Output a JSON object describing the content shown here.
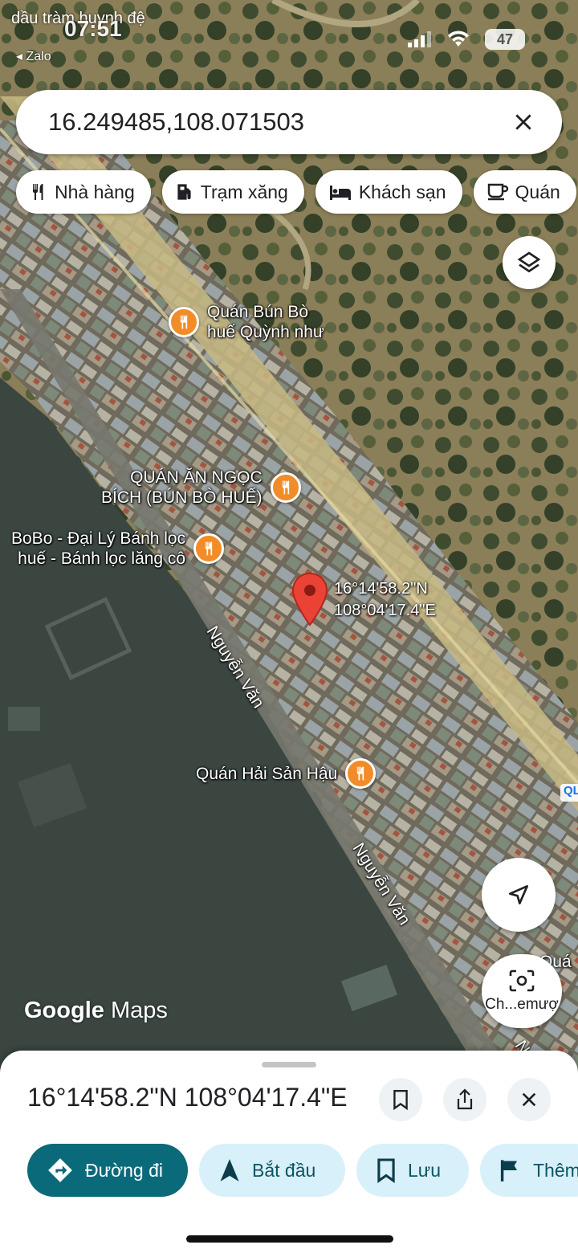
{
  "status_bar": {
    "back_app_text": "dầu tràm huynh đệ",
    "time": "07:51",
    "back_label": "◂ Zalo",
    "battery": "47"
  },
  "search": {
    "value": "16.249485,108.071503"
  },
  "chips": [
    {
      "label": "Nhà hàng",
      "icon": "fork-knife-icon"
    },
    {
      "label": "Trạm xăng",
      "icon": "gas-station-icon"
    },
    {
      "label": "Khách sạn",
      "icon": "bed-icon"
    },
    {
      "label": "Quán",
      "icon": "coffee-cup-icon"
    }
  ],
  "map": {
    "pois": [
      {
        "name_line1": "Quán Bún Bò",
        "name_line2": "huế Quỳnh như"
      },
      {
        "name_line1": "QUÁN ĂN NGỌC",
        "name_line2": "BÍCH (BÚN BÒ HUẾ)"
      },
      {
        "name_line1": "BoBo - Đại Lý Bánh lọc",
        "name_line2": "huế - Bánh lọc lăng cô"
      },
      {
        "name_line1": "Quán Hải Sản Hậu"
      }
    ],
    "streets": [
      "Nguyễn Văn",
      "Nguyễn Văn",
      "Nguy"
    ],
    "pin_coords_line1": "16°14'58.2\"N",
    "pin_coords_line2": "108°04'17.4\"E",
    "edge_label": "Quá nh",
    "road_badge": "QL",
    "logo_google": "Google",
    "logo_maps": "Maps",
    "lens_label": "Ch...emượ"
  },
  "sheet": {
    "title": "16°14'58.2\"N 108°04'17.4\"E",
    "actions": [
      {
        "label": "Đường đi",
        "icon": "directions-icon"
      },
      {
        "label": "Bắt đầu",
        "icon": "navigation-arrow-icon"
      },
      {
        "label": "Lưu",
        "icon": "bookmark-icon"
      },
      {
        "label": "Thêm",
        "icon": "flag-icon"
      }
    ]
  },
  "colors": {
    "poi_orange": "#f28c28",
    "pin_red": "#ea4335",
    "primary_teal": "#0b6a7a",
    "chip_light": "#d8f0fa"
  }
}
